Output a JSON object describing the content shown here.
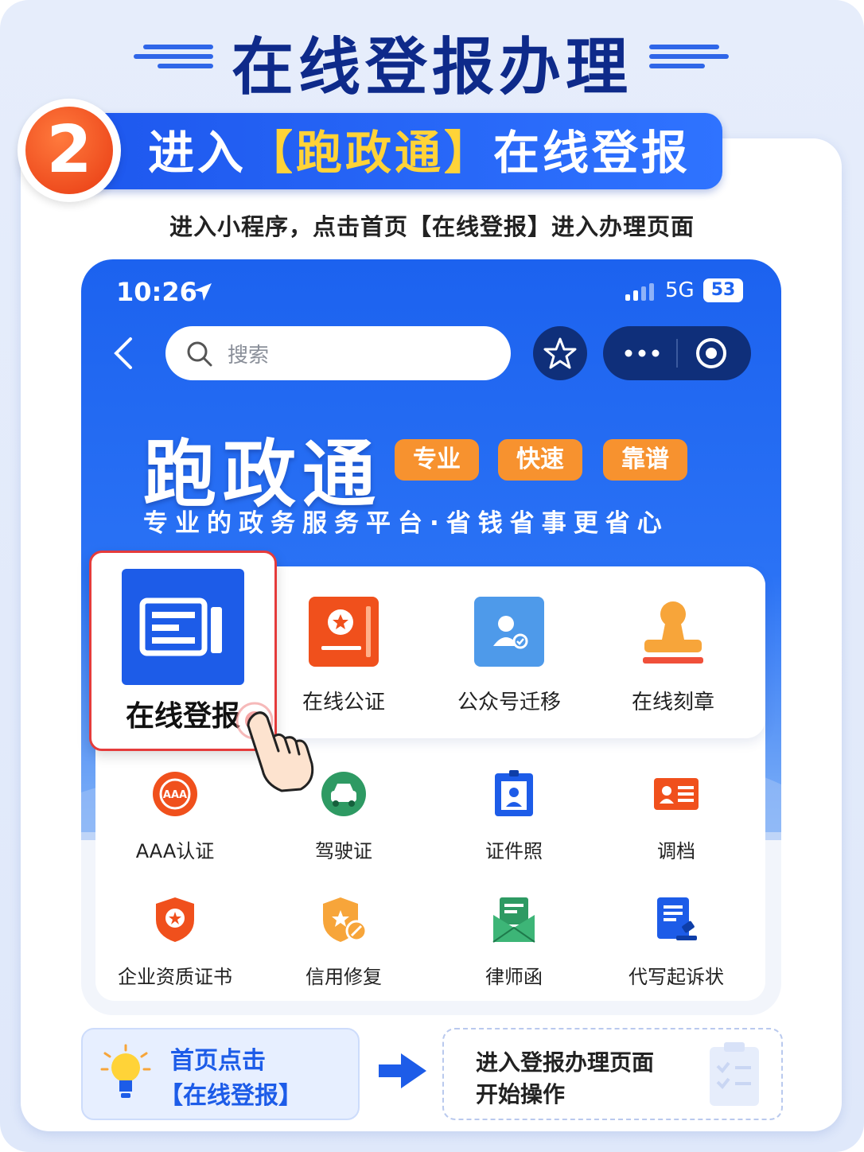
{
  "header": {
    "title": "在线登报办理"
  },
  "step": {
    "number": "2",
    "prefix": "进入",
    "highlight": "【跑政通】",
    "suffix": "在线登报",
    "subtitle": "进入小程序，点击首页【在线登报】进入办理页面"
  },
  "phone": {
    "status": {
      "time": "10:26",
      "network": "5G",
      "battery": "53"
    },
    "search": {
      "placeholder": "搜索"
    },
    "brand": "跑政通",
    "tags": [
      "专业",
      "快速",
      "靠谱"
    ],
    "slogan": "专业的政务服务平台·省钱省事更省心",
    "services_top": [
      {
        "label": "在线登报",
        "icon": "newspaper-icon"
      },
      {
        "label": "在线公证",
        "icon": "notary-icon"
      },
      {
        "label": "公众号迁移",
        "icon": "account-transfer-icon"
      },
      {
        "label": "在线刻章",
        "icon": "stamp-icon"
      }
    ],
    "services_row2": [
      {
        "label": "AAA认证",
        "icon": "aaa-badge-icon"
      },
      {
        "label": "驾驶证",
        "icon": "car-icon"
      },
      {
        "label": "证件照",
        "icon": "id-photo-icon"
      },
      {
        "label": "调档",
        "icon": "file-card-icon"
      }
    ],
    "services_row3": [
      {
        "label": "企业资质证书",
        "icon": "certificate-shield-icon"
      },
      {
        "label": "信用修复",
        "icon": "credit-repair-icon"
      },
      {
        "label": "律师函",
        "icon": "lawyer-letter-icon"
      },
      {
        "label": "代写起诉状",
        "icon": "lawsuit-doc-icon"
      }
    ]
  },
  "tips": {
    "left_line1": "首页点击",
    "left_line2": "【在线登报】",
    "right_line1": "进入登报办理页面",
    "right_line2": "开始操作"
  },
  "colors": {
    "primary": "#1d5ce8",
    "accent": "#ffd338",
    "orange": "#f7922f",
    "alert": "#e53b3b"
  }
}
